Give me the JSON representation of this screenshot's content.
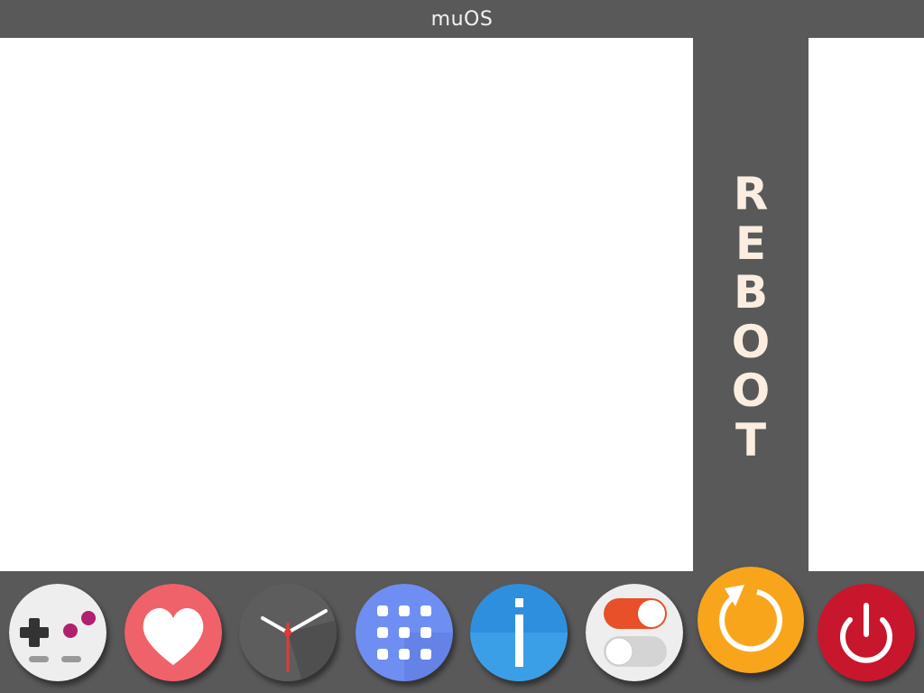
{
  "header": {
    "title": "muOS"
  },
  "panel": {
    "selected_label": "REBOOT",
    "letters": [
      "R",
      "E",
      "B",
      "O",
      "O",
      "T"
    ]
  },
  "dock": {
    "items": [
      {
        "icon": "gamepad-icon",
        "color": "#eeeeee"
      },
      {
        "icon": "heart-icon",
        "color": "#f0626a"
      },
      {
        "icon": "clock-icon",
        "color": "#5d5d5d"
      },
      {
        "icon": "apps-grid-icon",
        "color": "#6f8ef2"
      },
      {
        "icon": "info-icon",
        "color": "#2f8fdf"
      },
      {
        "icon": "toggles-icon",
        "color": "#eeeeee"
      },
      {
        "icon": "reboot-icon",
        "color": "#f9a51c",
        "selected": true
      },
      {
        "icon": "power-icon",
        "color": "#c8162c"
      }
    ]
  },
  "colors": {
    "background": "#595959",
    "content": "#ffffff",
    "label": "#fbeee0"
  }
}
